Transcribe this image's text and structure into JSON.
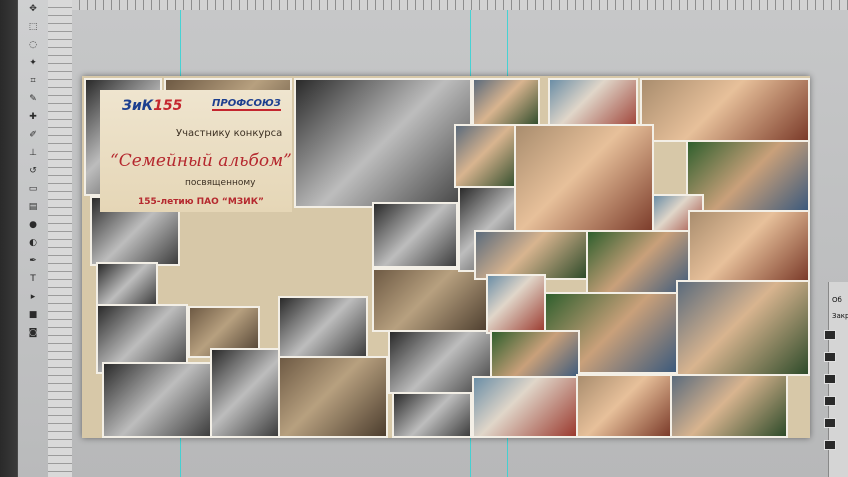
{
  "collage": {
    "logo_left_a": "ЗиК",
    "logo_left_b": "155",
    "logo_right": "ПРОФСОЮЗ",
    "participant": "Участнику конкурса",
    "album": "“Семейный альбом”",
    "dedicated": "посвященному",
    "anniversary": "155-летию ПАО “МЗИК”"
  },
  "right_panel": {
    "label_1": "Об",
    "label_2": "Закре"
  },
  "colors": {
    "accent_red": "#c4262e",
    "accent_blue": "#1c3f8f",
    "guide": "#2fd3d6"
  }
}
